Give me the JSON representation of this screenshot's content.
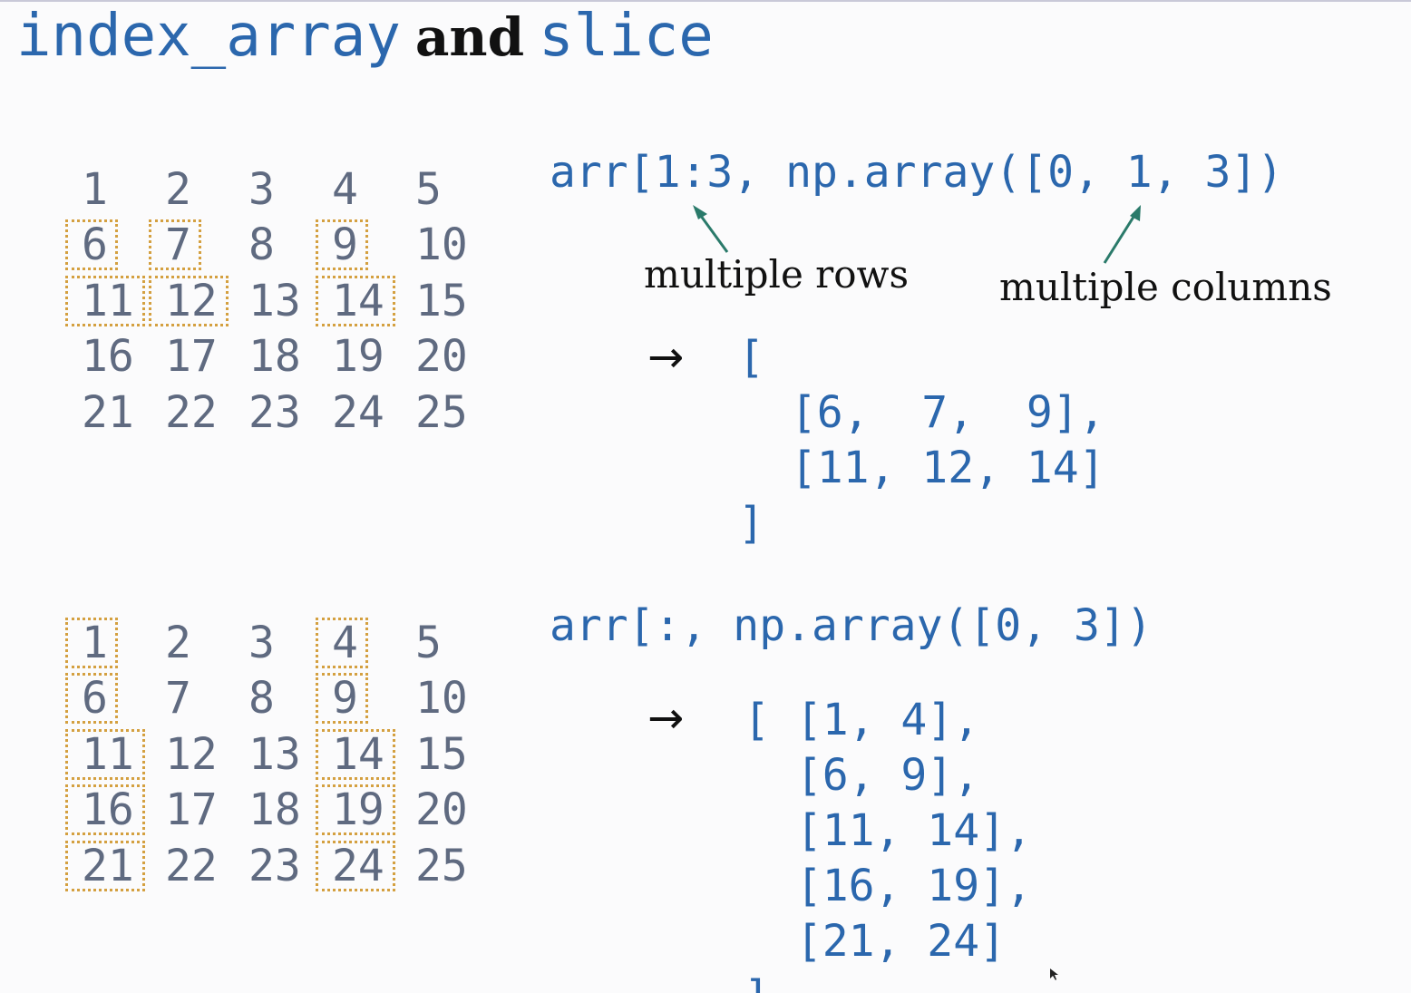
{
  "title": {
    "part1": "index_array",
    "part2": "and",
    "part3": "slice"
  },
  "grid": [
    [
      "1",
      "2",
      "3",
      "4",
      "5"
    ],
    [
      "6",
      "7",
      "8",
      "9",
      "10"
    ],
    [
      "11",
      "12",
      "13",
      "14",
      "15"
    ],
    [
      "16",
      "17",
      "18",
      "19",
      "20"
    ],
    [
      "21",
      "22",
      "23",
      "24",
      "25"
    ]
  ],
  "example1": {
    "expression": "arr[1:3, np.array([0, 1, 3])",
    "annotation_rows": "multiple rows",
    "annotation_columns": "multiple columns",
    "arrow": "→",
    "result_lines": [
      "[",
      "  [6,  7,  9],",
      "  [11, 12, 14]",
      "]"
    ],
    "highlighted_cells": [
      [
        1,
        0
      ],
      [
        1,
        1
      ],
      [
        1,
        3
      ],
      [
        2,
        0
      ],
      [
        2,
        1
      ],
      [
        2,
        3
      ]
    ]
  },
  "example2": {
    "expression": "arr[:, np.array([0, 3])",
    "arrow": "→",
    "result_lines": [
      "[ [1, 4],",
      "  [6, 9],",
      "  [11, 14],",
      "  [16, 19],",
      "  [21, 24]",
      "]"
    ],
    "highlighted_cells": [
      [
        0,
        0
      ],
      [
        0,
        3
      ],
      [
        1,
        0
      ],
      [
        1,
        3
      ],
      [
        2,
        0
      ],
      [
        2,
        3
      ],
      [
        3,
        0
      ],
      [
        3,
        3
      ],
      [
        4,
        0
      ],
      [
        4,
        3
      ]
    ]
  },
  "colors": {
    "code_blue": "#2b67ad",
    "grid_gray": "#5f6a80",
    "highlight_orange": "#d4a040",
    "pointer_teal": "#2a7a6a"
  }
}
